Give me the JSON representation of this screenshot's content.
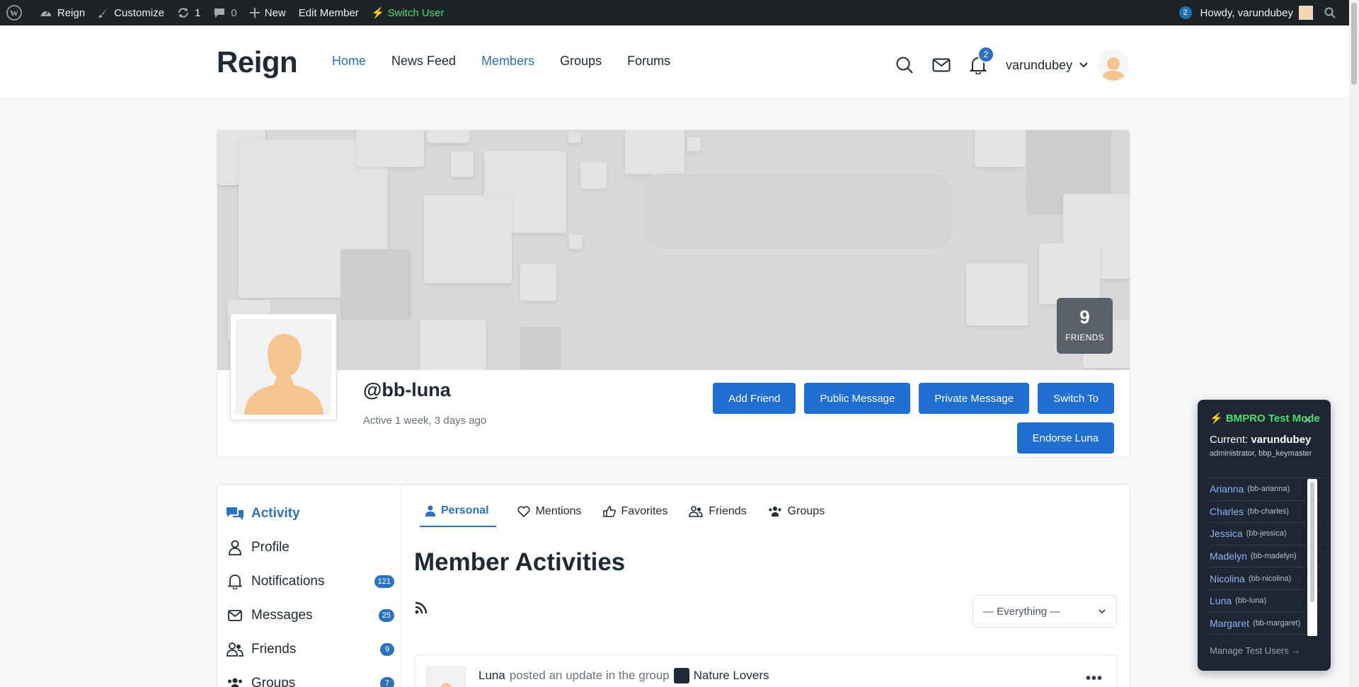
{
  "adminbar": {
    "site_name": "Reign",
    "customize": "Customize",
    "updates_count": "1",
    "comments_count": "0",
    "new_label": "New",
    "edit_member": "Edit Member",
    "switch_user": "Switch User",
    "notif_count": "2",
    "howdy": "Howdy, varundubey"
  },
  "header": {
    "logo": "Reign",
    "nav": [
      "Home",
      "News Feed",
      "Members",
      "Groups",
      "Forums"
    ],
    "notifications_count": "2",
    "username": "varundubey"
  },
  "profile": {
    "friends_count": "9",
    "friends_label": "FRIENDS",
    "handle": "@bb-luna",
    "last_active": "Active 1 week, 3 days ago",
    "actions": [
      "Add Friend",
      "Public Message",
      "Private Message",
      "Switch To"
    ],
    "endorse": "Endorse Luna"
  },
  "sidebar": {
    "items": [
      {
        "label": "Activity",
        "badge": ""
      },
      {
        "label": "Profile",
        "badge": ""
      },
      {
        "label": "Notifications",
        "badge": "121"
      },
      {
        "label": "Messages",
        "badge": "25"
      },
      {
        "label": "Friends",
        "badge": "9"
      },
      {
        "label": "Groups",
        "badge": "7"
      }
    ]
  },
  "main": {
    "tabs": [
      "Personal",
      "Mentions",
      "Favorites",
      "Friends",
      "Groups"
    ],
    "title": "Member Activities",
    "filter_value": "— Everything —",
    "activity": {
      "author": "Luna",
      "action": "posted an update in the group",
      "group": "Nature Lovers"
    }
  },
  "bmpro": {
    "title": "⚡ BMPRO Test Mode",
    "current_label": "Current:",
    "current_user": "varundubey",
    "roles": "administrator, bbp_keymaster",
    "users": [
      {
        "name": "Arianna",
        "slug": "(bb-arianna)"
      },
      {
        "name": "Charles",
        "slug": "(bb-charles)"
      },
      {
        "name": "Jessica",
        "slug": "(bb-jessica)"
      },
      {
        "name": "Madelyn",
        "slug": "(bb-madelyn)"
      },
      {
        "name": "Nicolina",
        "slug": "(bb-nicolina)"
      },
      {
        "name": "Luna",
        "slug": "(bb-luna)"
      },
      {
        "name": "Margaret",
        "slug": "(bb-margaret)"
      }
    ],
    "manage": "Manage Test Users →"
  }
}
